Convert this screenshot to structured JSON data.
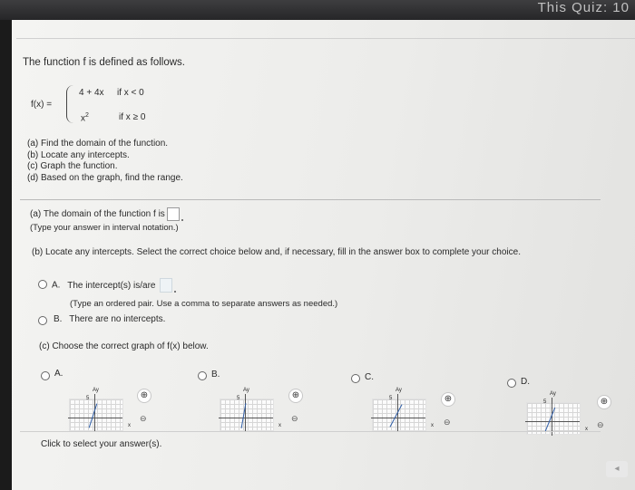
{
  "header": {
    "quiz_text": "This Quiz: 10",
    "partial_top_text": ""
  },
  "problem": {
    "intro": "The function f is defined as follows.",
    "fx_label": "f(x) =",
    "case1_expr": "4 + 4x",
    "case1_cond": "if x < 0",
    "case2_base": "x",
    "case2_exp": "2",
    "case2_cond": "if x ≥ 0",
    "parts": [
      "(a) Find the domain of the function.",
      "(b) Locate any intercepts.",
      "(c) Graph the function.",
      "(d) Based on the graph, find the range."
    ]
  },
  "part_a": {
    "question": "(a) The domain of the function f is",
    "hint": "(Type your answer in interval notation.)"
  },
  "part_b": {
    "question": "(b) Locate any intercepts. Select the correct choice below and, if necessary, fill in the answer box to complete your choice.",
    "option_a_letter": "A.",
    "option_a_text": "The intercept(s) is/are",
    "option_a_hint": "(Type an ordered pair. Use a comma to separate answers as needed.)",
    "option_b_letter": "B.",
    "option_b_text": "There are no intercepts."
  },
  "part_c": {
    "question": "(c) Choose the correct graph of f(x) below.",
    "options": [
      {
        "letter": "A."
      },
      {
        "letter": "B."
      },
      {
        "letter": "C."
      },
      {
        "letter": "D."
      }
    ],
    "graph_tick": "5",
    "graph_y": "Ay",
    "graph_x": "x"
  },
  "footer": {
    "click_text": "Click to select your answer(s)."
  },
  "icons": {
    "zoom_in": "zoom-in-icon",
    "zoom_out": "zoom-out-icon",
    "arrow": "◂"
  }
}
